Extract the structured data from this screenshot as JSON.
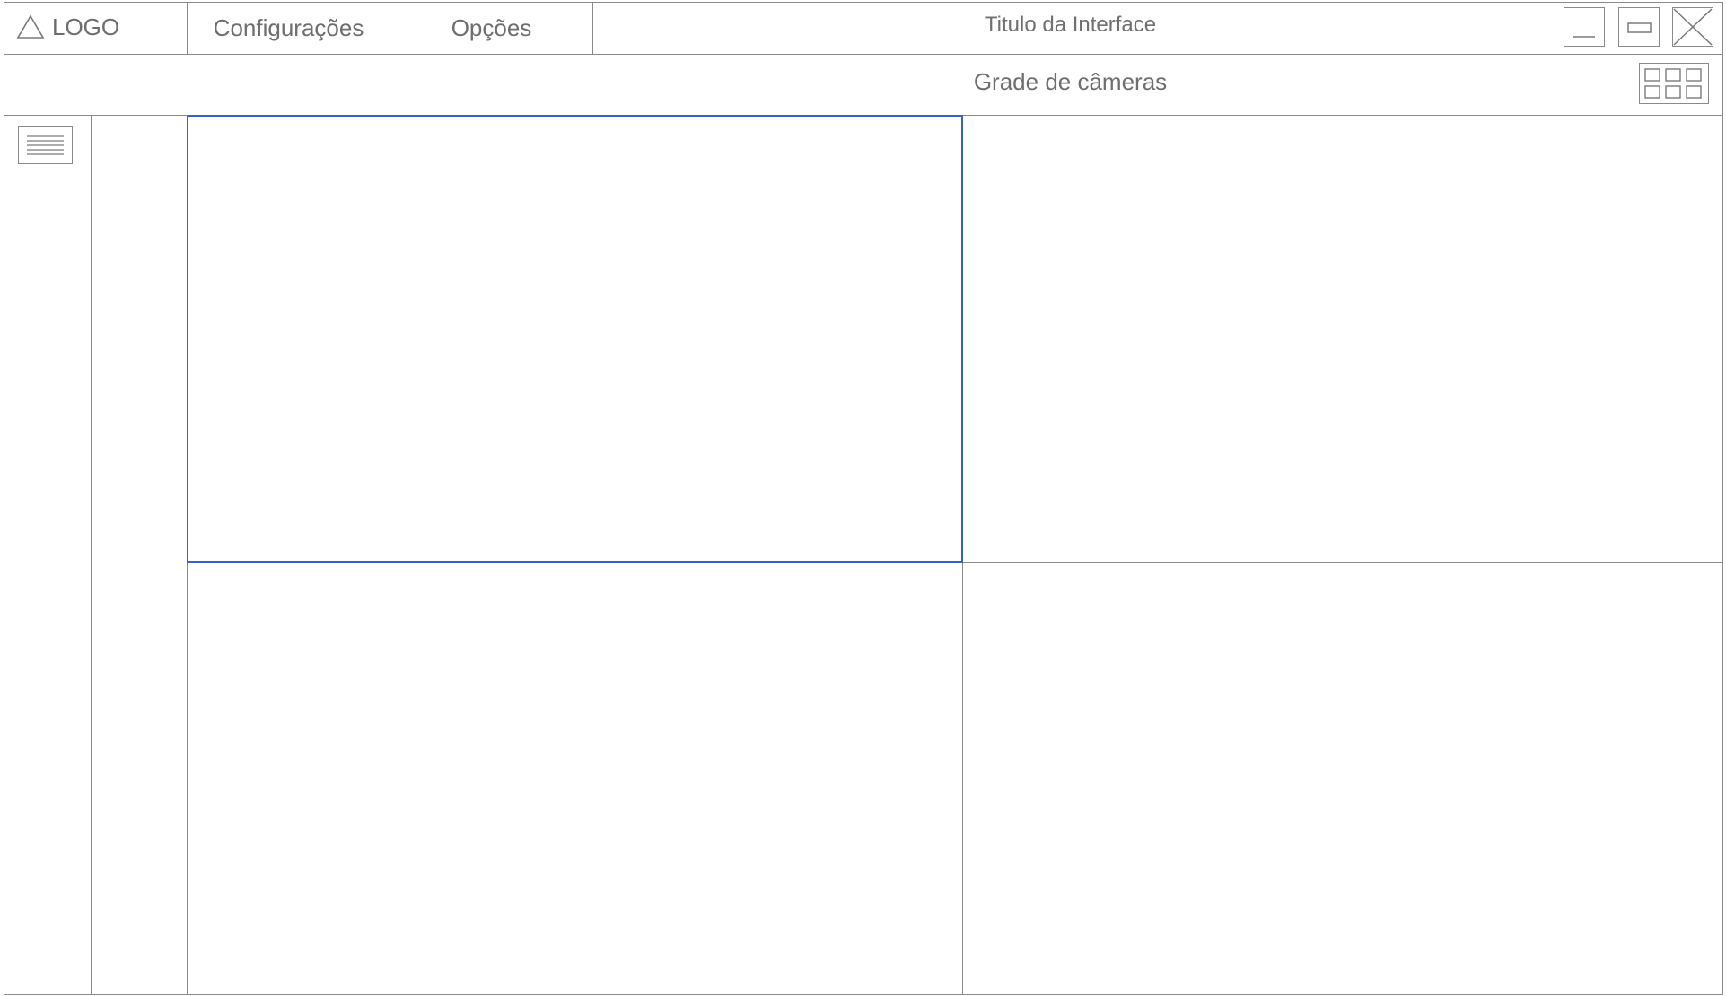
{
  "window": {
    "logo_label": "LOGO",
    "title": "Titulo da Interface"
  },
  "menu": {
    "items": [
      {
        "label": "Configurações"
      },
      {
        "label": "Opções"
      }
    ]
  },
  "window_controls": {
    "minimize_icon": "minimize-icon",
    "maximize_icon": "maximize-icon",
    "close_icon": "close-icon"
  },
  "subheader": {
    "title": "Grade de câmeras",
    "grid_layout_icon": "grid-layout-icon"
  },
  "sidebar": {
    "menu_icon": "hamburger-menu-icon"
  },
  "camera_grid": {
    "rows": 2,
    "columns": 2,
    "selected_index": 0,
    "cells": [
      "",
      "",
      "",
      ""
    ]
  },
  "colors": {
    "border": "#8a8a8a",
    "text": "#6e6e6e",
    "selected": "#3a62c4"
  }
}
